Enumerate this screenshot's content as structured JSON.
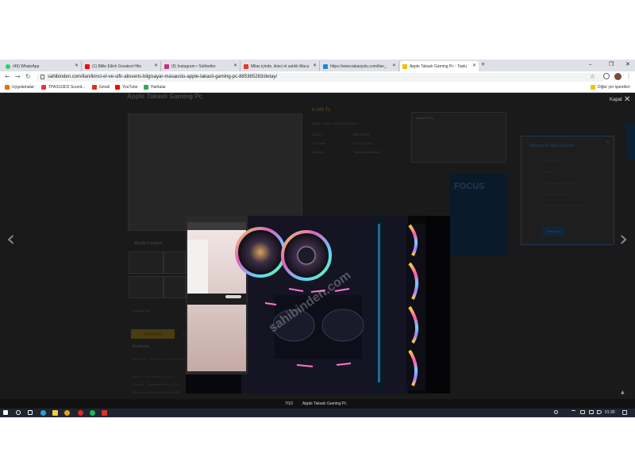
{
  "browser": {
    "tabs": [
      {
        "label": "(45) WhatsApp",
        "icon": "whatsapp-icon",
        "color": "#25d366",
        "active": false
      },
      {
        "label": "(1) Billie Eilish Greatest Hits",
        "icon": "youtube-icon",
        "color": "#ff0000",
        "active": false
      },
      {
        "label": "(5) Instagram • Sohbetler",
        "icon": "instagram-icon",
        "color": "#c13584",
        "active": false
      },
      {
        "label": "Milas içinde, ikinci el satılık Macu",
        "icon": "sahibinden-icon",
        "color": "#e53935",
        "active": false
      },
      {
        "label": "https://www.takasyolu.com/ilan_",
        "icon": "takasyolu-icon",
        "color": "#1e88e5",
        "active": false
      },
      {
        "label": "Apple Takaslı Gaming Pc - Toplu",
        "icon": "sahibinden-icon",
        "color": "#f2c200",
        "active": true
      }
    ],
    "new_tab": "+",
    "url": "sahibinden.com/ilan/ikinci-el-ve-sifir-alisveris-bilgisayar-masaustu-apple-takasli-gaming-pc-885365283/detay/",
    "bookmarks": [
      {
        "label": "Uygulamalar",
        "icon": "apps-icon",
        "color": "#e8710a"
      },
      {
        "label": "TPA3116D2 Sound...",
        "icon": "store-icon",
        "color": "#e53935"
      },
      {
        "label": "Gmail",
        "icon": "gmail-icon",
        "color": "#d93025"
      },
      {
        "label": "YouTube",
        "icon": "youtube-icon",
        "color": "#ff0000"
      },
      {
        "label": "Haritalar",
        "icon": "maps-icon",
        "color": "#34a853"
      }
    ],
    "other_bookmarks": "Diğer yer işaretleri"
  },
  "page": {
    "listing_title": "Apple Takaslı Gaming Pc",
    "price": "6.000 TL",
    "detail_rows": [
      {
        "label": "Muğla / Milas / Cumhuriyet Mah.",
        "value": ""
      },
      {
        "label": "İlan No",
        "value": "885365283"
      },
      {
        "label": "İlan Tarihi",
        "value": "12 Ocak 2021"
      },
      {
        "label": "Kategori",
        "value": "Toplama Masaüstü"
      }
    ],
    "seller_name": "Mehmet Bey",
    "big_photo": "Büyük Fotoğraf",
    "video_text": "Video ile İlgili",
    "tabs": [
      "İlan Detayları",
      "Konumu"
    ],
    "desc_heading": "Açıklama",
    "desc_lines": [
      "Sıfırdan 3 - 4k Beni - 11 günde ve takas olur, anlaşabilir değişirse samsung apple takas",
      "İşlemci : Amd Ryzen 5 3500X",
      "Anakart : Gigabyte B450M DS3H",
      "Ekran Kartı: Gtx 1660 Super 6GB"
    ],
    "ad_banner": "FOCUS",
    "related_panel": {
      "title": "İlanınız ile İlgili İşlemler",
      "close": "×",
      "items": [
        "Favorilerim",
        "Şikayet Et",
        "Aynı Kategorideki İlanlar",
        "Yazıcıya Gönder",
        "Sahibinden Güvenlik İpuçları"
      ],
      "button": "Hemen Al"
    }
  },
  "lightbox": {
    "close_label": "Kapat",
    "prev": "‹",
    "next": "›",
    "counter": "7/10",
    "caption": "Apple Takaslı Gaming Pc",
    "watermark": "sahibinden.com",
    "top_button": "▲"
  },
  "taskbar": {
    "time": "01:30",
    "apps": [
      {
        "name": "start-button",
        "color": "#ffffff"
      },
      {
        "name": "search-icon",
        "color": "#ffffff"
      },
      {
        "name": "task-view-icon",
        "color": "#ffffff"
      },
      {
        "name": "edge-icon",
        "color": "#2f9ae0"
      },
      {
        "name": "file-explorer-icon",
        "color": "#f7c84c"
      },
      {
        "name": "chrome-icon",
        "color": "#e4a11b"
      },
      {
        "name": "ms-store-icon",
        "color": "#3d8ee0"
      },
      {
        "name": "opera-icon",
        "color": "#e2262a"
      },
      {
        "name": "spotify-icon",
        "color": "#1db954"
      },
      {
        "name": "app-icon",
        "color": "#d9332b"
      }
    ]
  }
}
